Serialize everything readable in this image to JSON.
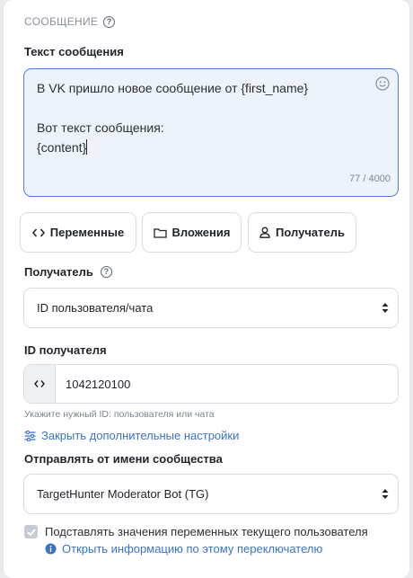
{
  "section": {
    "title": "СООБЩЕНИЕ"
  },
  "message": {
    "label": "Текст сообщения",
    "text": "В VK пришло новое сообщение от {first_name}\n\nВот текст сообщения:\n{content}",
    "counter": "77 / 4000"
  },
  "toolbar": {
    "variables_label": "Переменные",
    "attachments_label": "Вложения",
    "recipient_label": "Получатель"
  },
  "recipient": {
    "label": "Получатель",
    "selected": "ID пользователя/чата"
  },
  "recipient_id": {
    "label": "ID получателя",
    "value": "1042120100",
    "hint": "Укажите нужный ID: пользователя или чата"
  },
  "advanced_link": "Закрыть дополнительные настройки",
  "sender": {
    "label": "Отправлять от имени сообщества",
    "selected": "TargetHunter Moderator Bot (TG)"
  },
  "substitute": {
    "label": "Подставлять значения переменных текущего пользователя",
    "info_link": "Открыть информацию по этому переключателю"
  }
}
